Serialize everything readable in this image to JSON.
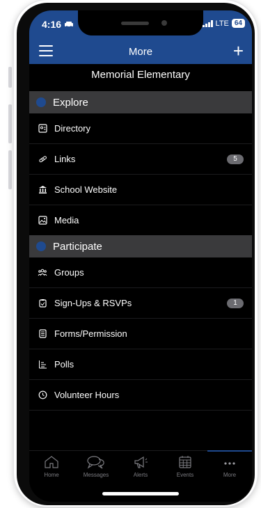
{
  "status_bar": {
    "time": "4:16",
    "network": "LTE",
    "battery": "64"
  },
  "header": {
    "title": "More"
  },
  "school_name": "Memorial Elementary",
  "sections": [
    {
      "title": "Explore",
      "items": [
        {
          "label": "Directory",
          "icon": "id-card-icon"
        },
        {
          "label": "Links",
          "icon": "link-icon",
          "badge": "5"
        },
        {
          "label": "School Website",
          "icon": "school-building-icon"
        },
        {
          "label": "Media",
          "icon": "image-icon"
        }
      ]
    },
    {
      "title": "Participate",
      "items": [
        {
          "label": "Groups",
          "icon": "groups-icon"
        },
        {
          "label": "Sign-Ups & RSVPs",
          "icon": "clipboard-check-icon",
          "badge": "1"
        },
        {
          "label": "Forms/Permission",
          "icon": "form-icon"
        },
        {
          "label": "Polls",
          "icon": "poll-icon"
        },
        {
          "label": "Volunteer Hours",
          "icon": "clock-icon"
        }
      ]
    }
  ],
  "tabs": [
    {
      "label": "Home",
      "icon": "home-icon"
    },
    {
      "label": "Messages",
      "icon": "messages-icon"
    },
    {
      "label": "Alerts",
      "icon": "megaphone-icon"
    },
    {
      "label": "Events",
      "icon": "calendar-icon"
    },
    {
      "label": "More",
      "icon": "more-dots-icon",
      "active": true
    }
  ],
  "colors": {
    "header": "#1f4a8f",
    "section_bg": "#3a3a3c",
    "screen_bg": "#000000",
    "tab_inactive": "#7b7b80"
  }
}
